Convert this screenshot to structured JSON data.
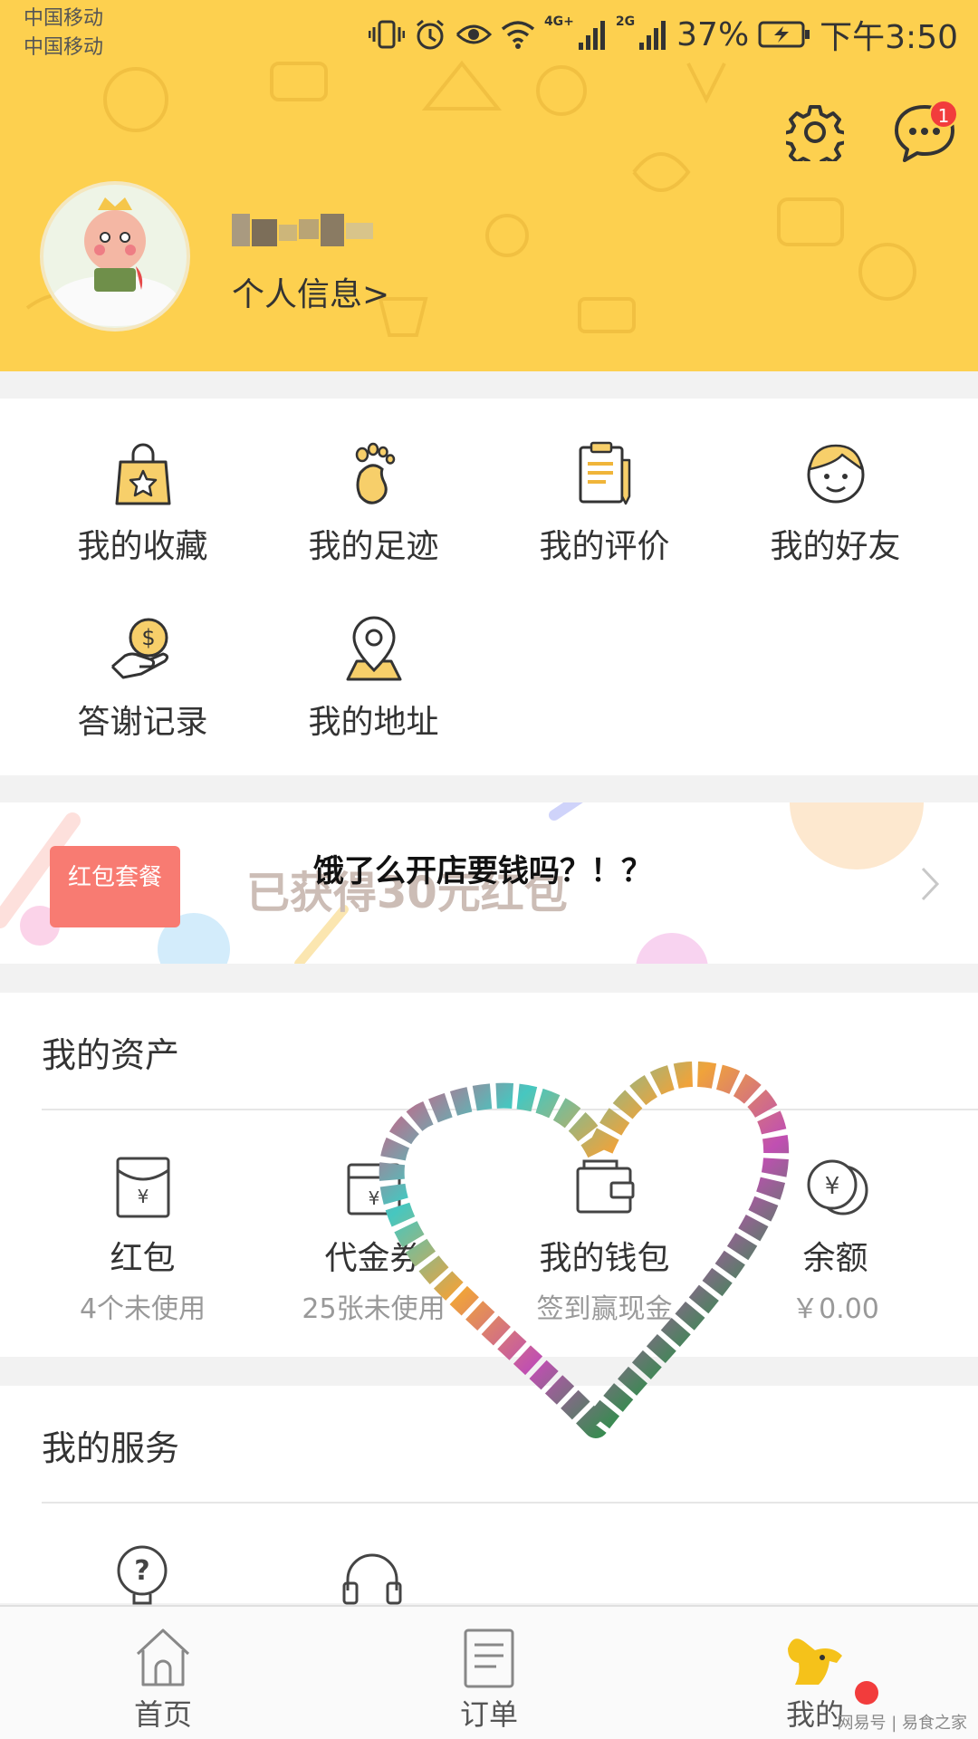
{
  "status_bar": {
    "carrier_1": "中国移动",
    "carrier_2": "中国移动",
    "net_1": "4G+",
    "net_2": "2G",
    "battery": "37%",
    "time": "下午3:50"
  },
  "header": {
    "message_badge": "1",
    "profile_link": "个人信息>"
  },
  "quick_menu": [
    {
      "label": "我的收藏",
      "icon": "bag-star-icon"
    },
    {
      "label": "我的足迹",
      "icon": "footprint-icon"
    },
    {
      "label": "我的评价",
      "icon": "clipboard-pen-icon"
    },
    {
      "label": "我的好友",
      "icon": "smiley-face-icon"
    },
    {
      "label": "答谢记录",
      "icon": "hand-coin-icon"
    },
    {
      "label": "我的地址",
      "icon": "location-pin-icon"
    }
  ],
  "promo": {
    "tag": "红包套餐",
    "text": "已获得30元红包",
    "overlay_title": "饿了么开店要钱吗？！？"
  },
  "assets": {
    "title": "我的资产",
    "items": [
      {
        "label": "红包",
        "sub": "4个未使用",
        "icon": "red-packet-icon"
      },
      {
        "label": "代金券",
        "sub": "25张未使用",
        "icon": "voucher-icon"
      },
      {
        "label": "我的钱包",
        "sub": "签到赢现金",
        "icon": "wallet-icon"
      },
      {
        "label": "余额",
        "sub": "￥0.00",
        "icon": "yen-coin-icon"
      }
    ]
  },
  "services": {
    "title": "我的服务",
    "icons": [
      "help-icon",
      "headset-icon"
    ]
  },
  "tabbar": {
    "items": [
      {
        "label": "首页",
        "icon": "home-icon"
      },
      {
        "label": "订单",
        "icon": "order-list-icon"
      },
      {
        "label": "我的",
        "icon": "mascot-icon"
      }
    ]
  },
  "watermark": "网易号 | 易食之家",
  "colors": {
    "header_bg": "#fdd04f",
    "icon_yellow": "#f7cf6a",
    "badge_red": "#f23c3c",
    "promo_tag": "#f87b72"
  }
}
